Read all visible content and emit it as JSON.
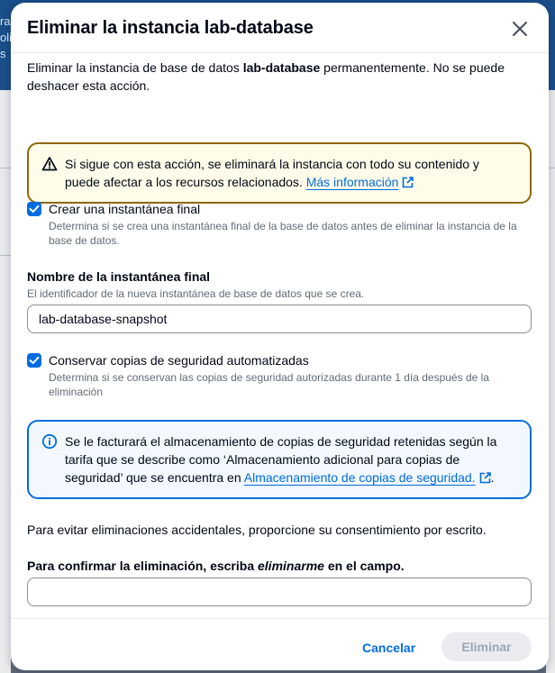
{
  "background": {
    "frag1": "ra",
    "frag2": "oli",
    "frag3": "s"
  },
  "modal": {
    "title": "Eliminar la instancia lab-database",
    "description_prefix": "Eliminar la instancia de base de datos ",
    "description_bold": "lab-database",
    "description_suffix": " permanentemente. No se puede deshacer esta acción.",
    "warning": {
      "text": "Si sigue con esta acción, se eliminará la instancia con todo su contenido y puede afectar a los recursos relacionados. ",
      "link": "Más información"
    },
    "final_snapshot": {
      "label": "Crear una instantánea final",
      "description": "Determina si se crea una instantánea final de la base de datos antes de eliminar la instancia de la base de datos."
    },
    "snapshot_name": {
      "label": "Nombre de la instantánea final",
      "description": "El identificador de la nueva instantánea de base de datos que se crea.",
      "value": "lab-database-snapshot"
    },
    "retain_backups": {
      "label": "Conservar copias de seguridad automatizadas",
      "description": "Determina si se conservan las copias de seguridad autorizadas durante 1 día después de la eliminación"
    },
    "info": {
      "text": "Se le facturará el almacenamiento de copias de seguridad retenidas según la tarifa que se describe como ‘Almacenamiento adicional para copias de seguridad’ que se encuentra en ",
      "link": "Almacenamiento de copias de seguridad.",
      "suffix": "."
    },
    "consent_text": "Para evitar eliminaciones accidentales, proporcione su consentimiento por escrito.",
    "confirm": {
      "label_prefix": "Para confirmar la eliminación, escriba ",
      "label_keyword": "eliminarme",
      "label_suffix": " en el campo.",
      "value": ""
    },
    "footer": {
      "cancel": "Cancelar",
      "delete": "Eliminar"
    }
  },
  "colors": {
    "primary": "#006ce0",
    "warning_border": "#8d6605",
    "warning_bg": "#fffce9",
    "info_bg": "#f2f8fd"
  }
}
